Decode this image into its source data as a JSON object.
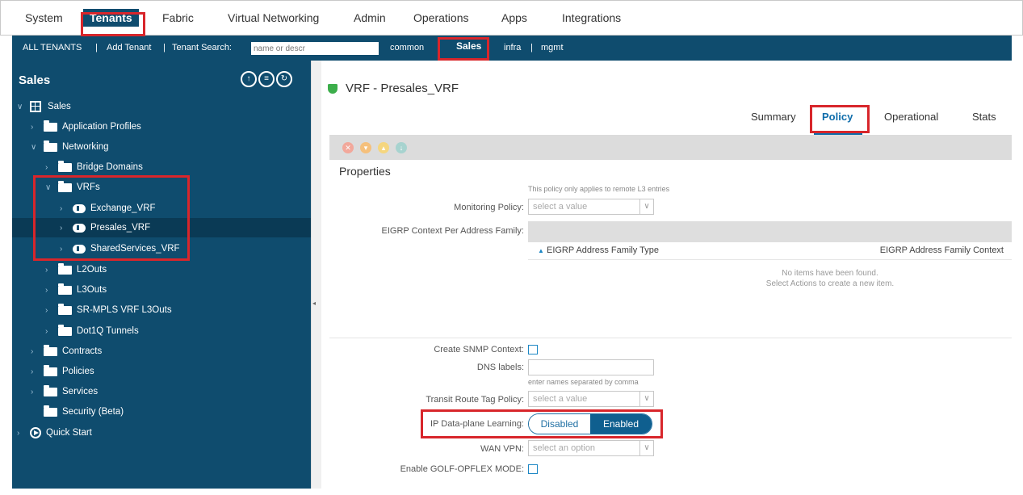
{
  "topnav": {
    "items": [
      "System",
      "Tenants",
      "Fabric",
      "Virtual Networking",
      "Admin",
      "Operations",
      "Apps",
      "Integrations"
    ],
    "active": "Tenants"
  },
  "subnav": {
    "all_tenants": "ALL TENANTS",
    "sep": "|",
    "add_tenant": "Add Tenant",
    "tenant_search_label": "Tenant Search:",
    "search_placeholder": "name or descr",
    "tenants": [
      "common",
      "Sales",
      "infra",
      "mgmt"
    ]
  },
  "left": {
    "title": "Sales",
    "tree": {
      "root": "Sales",
      "application_profiles": "Application Profiles",
      "networking": "Networking",
      "bridge_domains": "Bridge Domains",
      "vrfs": "VRFs",
      "vrf_exchange": "Exchange_VRF",
      "vrf_presales": "Presales_VRF",
      "vrf_shared": "SharedServices_VRF",
      "l2outs": "L2Outs",
      "l3outs": "L3Outs",
      "srmpls": "SR-MPLS VRF L3Outs",
      "dot1q": "Dot1Q Tunnels",
      "contracts": "Contracts",
      "policies": "Policies",
      "services": "Services",
      "security": "Security (Beta)",
      "quick_start": "Quick Start"
    }
  },
  "main": {
    "title": "VRF - Presales_VRF",
    "tabs": [
      "Summary",
      "Policy",
      "Operational",
      "Stats"
    ],
    "active_tab": "Policy",
    "properties_title": "Properties",
    "remote_hint": "This policy only applies to remote L3 entries",
    "monitoring_label": "Monitoring Policy:",
    "monitoring_placeholder": "select a value",
    "eigrp_label": "EIGRP Context Per Address Family:",
    "eigrp_col1": "EIGRP Address Family Type",
    "eigrp_col2": "EIGRP Address Family Context",
    "empty1": "No items have been found.",
    "empty2": "Select Actions to create a new item.",
    "snmp_label": "Create SNMP Context:",
    "dns_label": "DNS labels:",
    "dns_hint": "enter names separated by comma",
    "transit_label": "Transit Route Tag Policy:",
    "transit_placeholder": "select a value",
    "ip_learning_label": "IP Data-plane Learning:",
    "ip_learning_options": [
      "Disabled",
      "Enabled"
    ],
    "ip_learning_value": "Enabled",
    "wan_label": "WAN VPN:",
    "wan_placeholder": "select an option",
    "golf_label": "Enable GOLF-OPFLEX MODE:"
  },
  "colors": {
    "nav_dark": "#0f4c6e",
    "highlight_red": "#d8262b",
    "accent_blue": "#0f6dab",
    "vrf_icon_green": "#3cae4b"
  }
}
